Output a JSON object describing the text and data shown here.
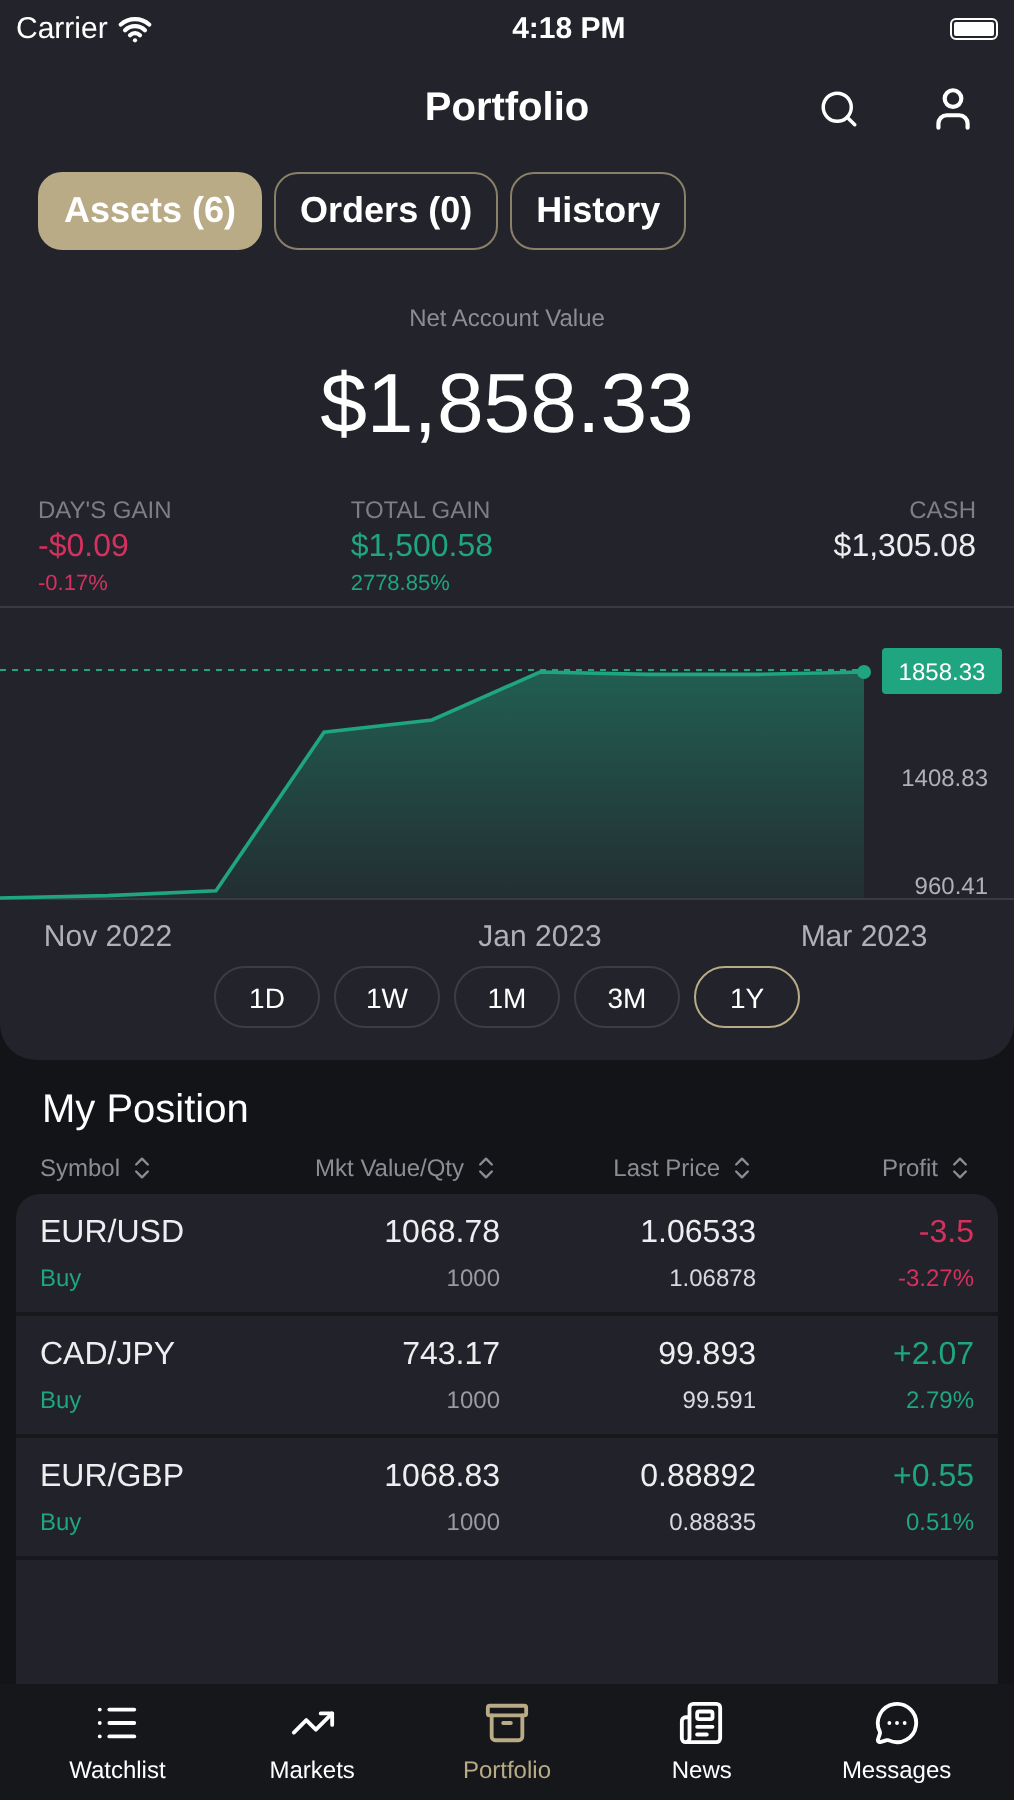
{
  "status_bar": {
    "carrier": "Carrier",
    "time": "4:18 PM"
  },
  "header": {
    "title": "Portfolio"
  },
  "tabs": [
    {
      "label": "Assets (6)",
      "selected": true
    },
    {
      "label": "Orders (0)",
      "selected": false
    },
    {
      "label": "History",
      "selected": false
    }
  ],
  "account": {
    "label": "Net Account Value",
    "value": "$1,858.33"
  },
  "stats": [
    {
      "label": "DAY'S GAIN",
      "value": "-$0.09",
      "percent": "-0.17%",
      "color": "#d6305f"
    },
    {
      "label": "TOTAL GAIN",
      "value": "$1,500.58",
      "percent": "2778.85%",
      "color": "#1fa57f"
    },
    {
      "label": "CASH",
      "value": "$1,305.08"
    }
  ],
  "chart_data": {
    "type": "area",
    "categories": [
      null,
      "Nov 2022",
      null,
      null,
      null,
      "Jan 2023",
      null,
      null,
      "Mar 2023"
    ],
    "series": [
      {
        "color": "#1fa57f",
        "values": [
          910,
          920,
          940,
          1600,
          1650,
          1850,
          1840,
          1840,
          1850
        ]
      }
    ],
    "ylim": [
      910,
      1858.33
    ],
    "yticks": [
      960.41,
      1408.83,
      1858.33
    ]
  },
  "ranges": [
    {
      "label": "1D",
      "selected": false
    },
    {
      "label": "1W",
      "selected": false
    },
    {
      "label": "1M",
      "selected": false
    },
    {
      "label": "3M",
      "selected": false
    },
    {
      "label": "1Y",
      "selected": true
    }
  ],
  "positions": {
    "title": "My Position",
    "columns": [
      "Symbol",
      "Mkt Value/Qty",
      "Last Price",
      "Profit"
    ],
    "rows": [
      {
        "symbol": "EUR/USD",
        "side": "Buy",
        "value": "1068.78",
        "qty": "1000",
        "price": "1.06533",
        "cost": "1.06878",
        "profit": "-3.5",
        "profit_percent": "-3.27%",
        "color": "#d6305f"
      },
      {
        "symbol": "CAD/JPY",
        "side": "Buy",
        "value": "743.17",
        "qty": "1000",
        "price": "99.893",
        "cost": "99.591",
        "profit": "+2.07",
        "profit_percent": "2.79%",
        "color": "#1fa57f"
      },
      {
        "symbol": "EUR/GBP",
        "side": "Buy",
        "value": "1068.83",
        "qty": "1000",
        "price": "0.88892",
        "cost": "0.88835",
        "profit": "+0.55",
        "profit_percent": "0.51%",
        "color": "#1fa57f"
      }
    ]
  },
  "tab_bar": [
    {
      "label": "Watchlist",
      "kind": "watchlist",
      "selected": false
    },
    {
      "label": "Markets",
      "kind": "markets",
      "selected": false
    },
    {
      "label": "Portfolio",
      "kind": "portfolio",
      "selected": true
    },
    {
      "label": "News",
      "kind": "news",
      "selected": false
    },
    {
      "label": "Messages",
      "kind": "messages",
      "selected": false
    }
  ]
}
